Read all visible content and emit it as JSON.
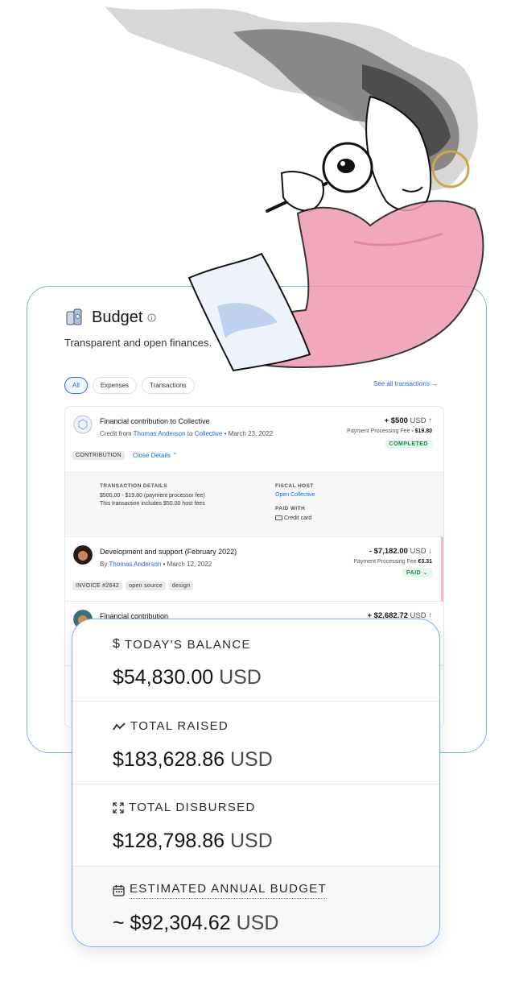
{
  "budget": {
    "title": "Budget",
    "subtitle": "Transparent and open finances.",
    "tabs": [
      {
        "label": "All",
        "active": true
      },
      {
        "label": "Expenses",
        "active": false
      },
      {
        "label": "Transactions",
        "active": false
      }
    ],
    "see_all": "See all transactions →"
  },
  "transactions": [
    {
      "title": "Financial contribution to Collective",
      "meta_prefix": "Credit from ",
      "from": "Thomas Anderson",
      "meta_mid": " to ",
      "to": "Collective",
      "date": " • March 23, 2022",
      "amount": "+ $500",
      "currency": "USD",
      "direction": "up",
      "fee_label": "Payment Processing Fee",
      "fee_value": "- $19.80",
      "status": "COMPLETED",
      "tag": "CONTRIBUTION",
      "close_details": "Close Details ⌃",
      "details": {
        "tx_label": "TRANSACTION DETAILS",
        "tx_line1": "$500.00 - $19.80 (payment processor fee)",
        "tx_line2": "This transaction includes $50.00 host fees",
        "host_label": "FISCAL HOST",
        "host_value": "Open Collective",
        "paid_label": "PAID WITH",
        "paid_value": "Credit card"
      }
    },
    {
      "title": "Development and support (February 2022)",
      "meta_prefix": "By ",
      "from": "Thomas Anderson",
      "date": " • March 12, 2022",
      "amount": "- $7,182.00",
      "currency": "USD",
      "direction": "down",
      "fee_label": "Payment Processing Fee",
      "fee_value": "€3.31",
      "status": "PAID ⌄",
      "tags": [
        "INVOICE #2642",
        "open source",
        "design"
      ]
    },
    {
      "title": "Financial contribution",
      "amount": "+ $2,682.72",
      "currency": "USD",
      "direction": "up"
    }
  ],
  "stats": [
    {
      "icon": "dollar-icon",
      "label": "TODAY'S BALANCE",
      "value": "$54,830.00",
      "currency": "USD"
    },
    {
      "icon": "trend-icon",
      "label": "TOTAL RAISED",
      "value": "$183,628.86",
      "currency": "USD"
    },
    {
      "icon": "expand-arrows-icon",
      "label": "TOTAL DISBURSED",
      "value": "$128,798.86",
      "currency": "USD"
    },
    {
      "icon": "calendar-icon",
      "label": "ESTIMATED ANNUAL BUDGET",
      "value": "~ $92,304.62",
      "currency": "USD"
    }
  ],
  "colors": {
    "accent": "#1869f5",
    "card_border": "#78aef2",
    "positive": "#0aa04f",
    "negative": "#e03b3b"
  }
}
